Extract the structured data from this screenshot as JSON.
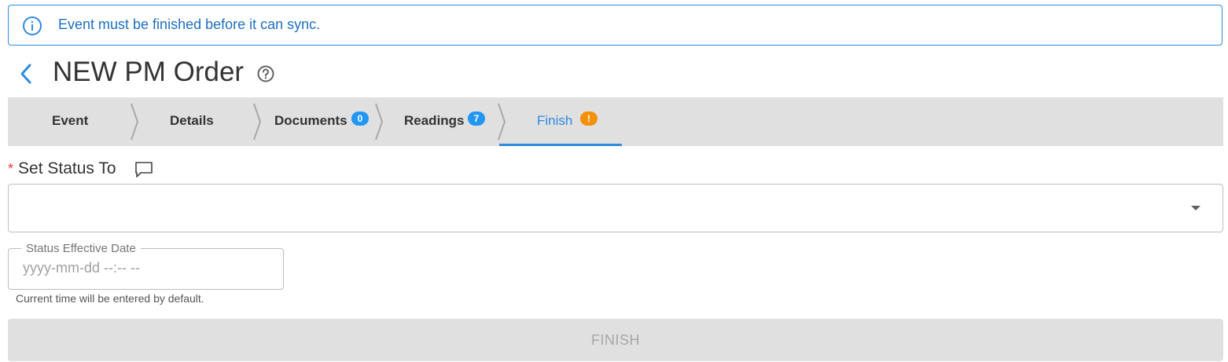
{
  "banner": {
    "message": "Event must be finished before it can sync.",
    "icon": "info-icon"
  },
  "header": {
    "title": "NEW PM Order",
    "back_icon": "chevron-left-icon",
    "help_icon": "help-circle-icon"
  },
  "tabs": [
    {
      "label": "Event"
    },
    {
      "label": "Details"
    },
    {
      "label": "Documents",
      "badge": "0",
      "badge_color": "#2196f3"
    },
    {
      "label": "Readings",
      "badge": "7",
      "badge_color": "#2196f3"
    },
    {
      "label": "Finish",
      "badge": "!",
      "badge_color": "#f5900a",
      "active": true
    }
  ],
  "form": {
    "required_marker": "*",
    "status_label": "Set Status To",
    "status_value": "",
    "date_label": "Status Effective Date",
    "date_placeholder": "yyyy-mm-dd --:-- --",
    "date_hint": "Current time will be entered by default.",
    "finish_label": "FINISH"
  },
  "colors": {
    "accent": "#2f8ae0",
    "tabbar_bg": "#e0e0e0",
    "required": "#e53935"
  }
}
